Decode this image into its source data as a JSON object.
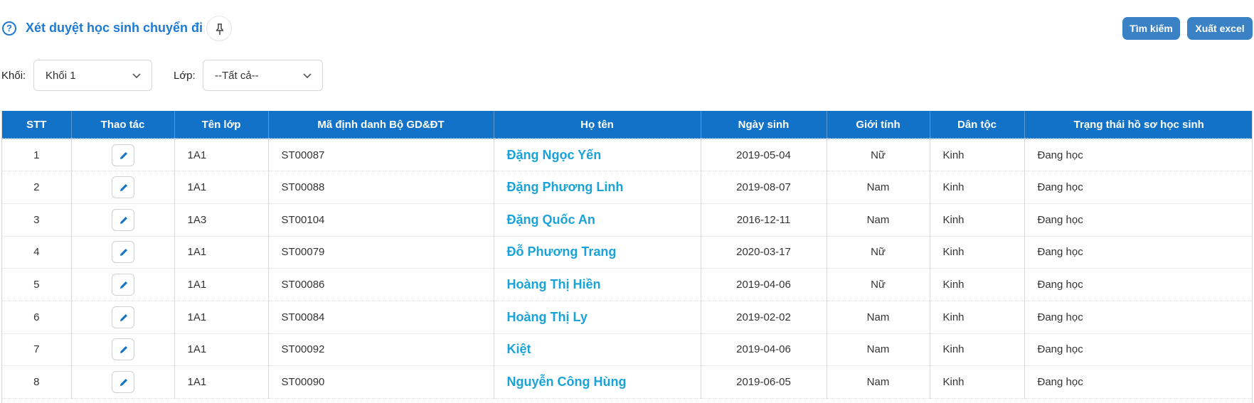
{
  "header": {
    "title": "Xét duyệt học sinh chuyển đi",
    "help_icon": "question-circle-icon",
    "pin_icon": "pin-icon",
    "search_label": "Tìm kiếm",
    "export_label": "Xuất excel"
  },
  "colors": {
    "accent": "#1f7ad1",
    "table_header_bg": "#1172c7",
    "button_bg": "#3b82c4",
    "name_link": "#19a3d8"
  },
  "filters": {
    "grade_label": "Khối:",
    "grade_value": "Khối 1",
    "class_label": "Lớp:",
    "class_value": "--Tất cả--"
  },
  "table": {
    "columns": [
      "STT",
      "Thao tác",
      "Tên lớp",
      "Mã định danh Bộ GD&ĐT",
      "Họ tên",
      "Ngày sinh",
      "Giới tính",
      "Dân tộc",
      "Trạng thái hồ sơ học sinh"
    ],
    "edit_icon": "pencil-icon",
    "rows": [
      {
        "stt": "1",
        "class": "1A1",
        "code": "ST00087",
        "name": "Đặng Ngọc Yến",
        "dob": "2019-05-04",
        "gender": "Nữ",
        "ethnicity": "Kinh",
        "status": "Đang học"
      },
      {
        "stt": "2",
        "class": "1A1",
        "code": "ST00088",
        "name": "Đặng Phương Linh",
        "dob": "2019-08-07",
        "gender": "Nam",
        "ethnicity": "Kinh",
        "status": "Đang học"
      },
      {
        "stt": "3",
        "class": "1A3",
        "code": "ST00104",
        "name": "Đặng Quốc An",
        "dob": "2016-12-11",
        "gender": "Nam",
        "ethnicity": "Kinh",
        "status": "Đang học"
      },
      {
        "stt": "4",
        "class": "1A1",
        "code": "ST00079",
        "name": "Đỗ Phương Trang",
        "dob": "2020-03-17",
        "gender": "Nữ",
        "ethnicity": "Kinh",
        "status": "Đang học"
      },
      {
        "stt": "5",
        "class": "1A1",
        "code": "ST00086",
        "name": "Hoàng Thị Hiền",
        "dob": "2019-04-06",
        "gender": "Nữ",
        "ethnicity": "Kinh",
        "status": "Đang học"
      },
      {
        "stt": "6",
        "class": "1A1",
        "code": "ST00084",
        "name": "Hoàng Thị Ly",
        "dob": "2019-02-02",
        "gender": "Nam",
        "ethnicity": "Kinh",
        "status": "Đang học"
      },
      {
        "stt": "7",
        "class": "1A1",
        "code": "ST00092",
        "name": "Kiệt",
        "dob": "2019-04-06",
        "gender": "Nam",
        "ethnicity": "Kinh",
        "status": "Đang học"
      },
      {
        "stt": "8",
        "class": "1A1",
        "code": "ST00090",
        "name": "Nguyễn Công Hùng",
        "dob": "2019-06-05",
        "gender": "Nam",
        "ethnicity": "Kinh",
        "status": "Đang học"
      }
    ]
  }
}
